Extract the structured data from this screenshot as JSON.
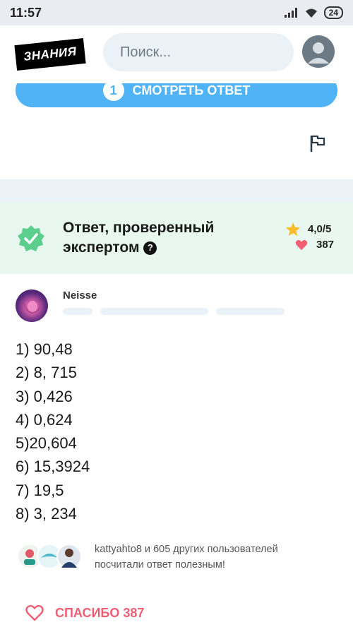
{
  "status_bar": {
    "time": "11:57",
    "battery": "24"
  },
  "header": {
    "logo": "ЗНАНИЯ",
    "search_placeholder": "Поиск..."
  },
  "view_answer": {
    "count": "1",
    "label": "СМОТРЕТЬ ОТВЕТ"
  },
  "expert": {
    "title_line1": "Ответ, проверенный",
    "title_line2": "экспертом",
    "help": "?",
    "rating": "4,0/5",
    "likes": "387"
  },
  "author": {
    "name": "Neisse"
  },
  "answer_lines": [
    "1) 90,48",
    "2) 8, 715",
    "3) 0,426",
    "4) 0,624",
    "5)20,604",
    "6) 15,3924",
    "7) 19,5",
    "8) 3, 234"
  ],
  "helpful": {
    "line1": "kattyahto8 и 605 других пользователей",
    "line2": "посчитали ответ полезным!"
  },
  "thanks": {
    "label": "СПАСИБО 387"
  },
  "colors": {
    "accent_blue": "#4fb3f6",
    "expert_bg": "#e8f7f0",
    "expert_green": "#5ccf8f",
    "star": "#fbbe2e",
    "heart": "#f15e74"
  }
}
